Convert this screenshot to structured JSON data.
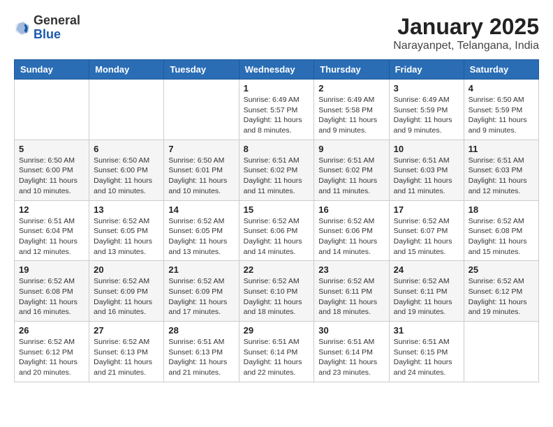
{
  "logo": {
    "general": "General",
    "blue": "Blue"
  },
  "header": {
    "month": "January 2025",
    "location": "Narayanpet, Telangana, India"
  },
  "weekdays": [
    "Sunday",
    "Monday",
    "Tuesday",
    "Wednesday",
    "Thursday",
    "Friday",
    "Saturday"
  ],
  "weeks": [
    [
      {
        "day": "",
        "info": ""
      },
      {
        "day": "",
        "info": ""
      },
      {
        "day": "",
        "info": ""
      },
      {
        "day": "1",
        "info": "Sunrise: 6:49 AM\nSunset: 5:57 PM\nDaylight: 11 hours and 8 minutes."
      },
      {
        "day": "2",
        "info": "Sunrise: 6:49 AM\nSunset: 5:58 PM\nDaylight: 11 hours and 9 minutes."
      },
      {
        "day": "3",
        "info": "Sunrise: 6:49 AM\nSunset: 5:59 PM\nDaylight: 11 hours and 9 minutes."
      },
      {
        "day": "4",
        "info": "Sunrise: 6:50 AM\nSunset: 5:59 PM\nDaylight: 11 hours and 9 minutes."
      }
    ],
    [
      {
        "day": "5",
        "info": "Sunrise: 6:50 AM\nSunset: 6:00 PM\nDaylight: 11 hours and 10 minutes."
      },
      {
        "day": "6",
        "info": "Sunrise: 6:50 AM\nSunset: 6:00 PM\nDaylight: 11 hours and 10 minutes."
      },
      {
        "day": "7",
        "info": "Sunrise: 6:50 AM\nSunset: 6:01 PM\nDaylight: 11 hours and 10 minutes."
      },
      {
        "day": "8",
        "info": "Sunrise: 6:51 AM\nSunset: 6:02 PM\nDaylight: 11 hours and 11 minutes."
      },
      {
        "day": "9",
        "info": "Sunrise: 6:51 AM\nSunset: 6:02 PM\nDaylight: 11 hours and 11 minutes."
      },
      {
        "day": "10",
        "info": "Sunrise: 6:51 AM\nSunset: 6:03 PM\nDaylight: 11 hours and 11 minutes."
      },
      {
        "day": "11",
        "info": "Sunrise: 6:51 AM\nSunset: 6:03 PM\nDaylight: 11 hours and 12 minutes."
      }
    ],
    [
      {
        "day": "12",
        "info": "Sunrise: 6:51 AM\nSunset: 6:04 PM\nDaylight: 11 hours and 12 minutes."
      },
      {
        "day": "13",
        "info": "Sunrise: 6:52 AM\nSunset: 6:05 PM\nDaylight: 11 hours and 13 minutes."
      },
      {
        "day": "14",
        "info": "Sunrise: 6:52 AM\nSunset: 6:05 PM\nDaylight: 11 hours and 13 minutes."
      },
      {
        "day": "15",
        "info": "Sunrise: 6:52 AM\nSunset: 6:06 PM\nDaylight: 11 hours and 14 minutes."
      },
      {
        "day": "16",
        "info": "Sunrise: 6:52 AM\nSunset: 6:06 PM\nDaylight: 11 hours and 14 minutes."
      },
      {
        "day": "17",
        "info": "Sunrise: 6:52 AM\nSunset: 6:07 PM\nDaylight: 11 hours and 15 minutes."
      },
      {
        "day": "18",
        "info": "Sunrise: 6:52 AM\nSunset: 6:08 PM\nDaylight: 11 hours and 15 minutes."
      }
    ],
    [
      {
        "day": "19",
        "info": "Sunrise: 6:52 AM\nSunset: 6:08 PM\nDaylight: 11 hours and 16 minutes."
      },
      {
        "day": "20",
        "info": "Sunrise: 6:52 AM\nSunset: 6:09 PM\nDaylight: 11 hours and 16 minutes."
      },
      {
        "day": "21",
        "info": "Sunrise: 6:52 AM\nSunset: 6:09 PM\nDaylight: 11 hours and 17 minutes."
      },
      {
        "day": "22",
        "info": "Sunrise: 6:52 AM\nSunset: 6:10 PM\nDaylight: 11 hours and 18 minutes."
      },
      {
        "day": "23",
        "info": "Sunrise: 6:52 AM\nSunset: 6:11 PM\nDaylight: 11 hours and 18 minutes."
      },
      {
        "day": "24",
        "info": "Sunrise: 6:52 AM\nSunset: 6:11 PM\nDaylight: 11 hours and 19 minutes."
      },
      {
        "day": "25",
        "info": "Sunrise: 6:52 AM\nSunset: 6:12 PM\nDaylight: 11 hours and 19 minutes."
      }
    ],
    [
      {
        "day": "26",
        "info": "Sunrise: 6:52 AM\nSunset: 6:12 PM\nDaylight: 11 hours and 20 minutes."
      },
      {
        "day": "27",
        "info": "Sunrise: 6:52 AM\nSunset: 6:13 PM\nDaylight: 11 hours and 21 minutes."
      },
      {
        "day": "28",
        "info": "Sunrise: 6:51 AM\nSunset: 6:13 PM\nDaylight: 11 hours and 21 minutes."
      },
      {
        "day": "29",
        "info": "Sunrise: 6:51 AM\nSunset: 6:14 PM\nDaylight: 11 hours and 22 minutes."
      },
      {
        "day": "30",
        "info": "Sunrise: 6:51 AM\nSunset: 6:14 PM\nDaylight: 11 hours and 23 minutes."
      },
      {
        "day": "31",
        "info": "Sunrise: 6:51 AM\nSunset: 6:15 PM\nDaylight: 11 hours and 24 minutes."
      },
      {
        "day": "",
        "info": ""
      }
    ]
  ]
}
